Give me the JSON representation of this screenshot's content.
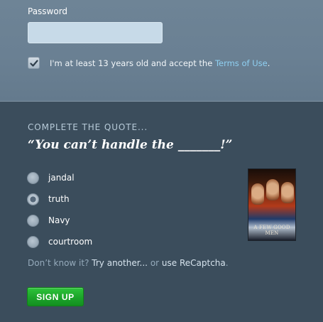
{
  "password": {
    "label": "Password",
    "value": "",
    "placeholder": "",
    "input_color": "#c7dae8"
  },
  "terms": {
    "checked": true,
    "text": "I'm at least 13 years old and accept the ",
    "link": "Terms of Use",
    "suffix": "."
  },
  "captcha": {
    "heading": "COMPLETE THE QUOTE...",
    "quote": "“You can’t handle the _______!”",
    "options": [
      {
        "label": "jandal",
        "selected": false
      },
      {
        "label": "truth",
        "selected": true
      },
      {
        "label": "Navy",
        "selected": false
      },
      {
        "label": "courtroom",
        "selected": false
      }
    ],
    "poster_title": "A FEW GOOD MEN"
  },
  "help": {
    "prefix": "Don’t know it?",
    "try_another": "Try another...",
    "or": "or",
    "use_recaptcha": "use ReCaptcha",
    "suffix": "."
  },
  "signup": {
    "label": "SIGN UP",
    "color": "#1ca42a"
  },
  "colors": {
    "top_bg": "#6a8093",
    "bottom_bg": "#3b4d5c",
    "link": "#8fd0f2"
  }
}
